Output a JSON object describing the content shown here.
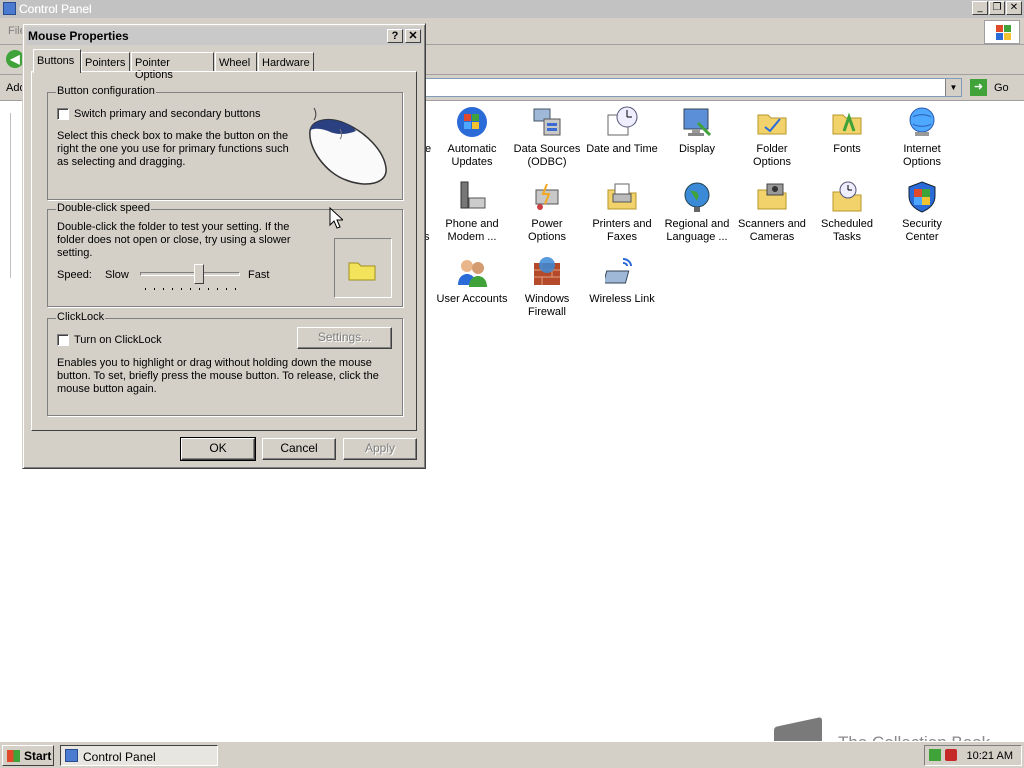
{
  "control_panel": {
    "title": "Control Panel",
    "menu_first": "File",
    "address_label": "Address",
    "go_label": "Go",
    "partial_labels": [
      "e",
      "s",
      "l"
    ],
    "icons": [
      {
        "label": "Automatic Updates",
        "icon": "automatic-updates-icon"
      },
      {
        "label": "Data Sources (ODBC)",
        "icon": "data-sources-icon"
      },
      {
        "label": "Date and Time",
        "icon": "date-time-icon"
      },
      {
        "label": "Display",
        "icon": "display-icon"
      },
      {
        "label": "Folder Options",
        "icon": "folder-options-icon"
      },
      {
        "label": "Fonts",
        "icon": "fonts-icon"
      },
      {
        "label": "Internet Options",
        "icon": "internet-options-icon"
      },
      {
        "label": "Phone and Modem ...",
        "icon": "phone-modem-icon"
      },
      {
        "label": "Power Options",
        "icon": "power-options-icon"
      },
      {
        "label": "Printers and Faxes",
        "icon": "printers-icon"
      },
      {
        "label": "Regional and Language ...",
        "icon": "regional-icon"
      },
      {
        "label": "Scanners and Cameras",
        "icon": "scanners-icon"
      },
      {
        "label": "Scheduled Tasks",
        "icon": "scheduled-tasks-icon"
      },
      {
        "label": "Security Center",
        "icon": "security-center-icon"
      },
      {
        "label": "User Accounts",
        "icon": "user-accounts-icon"
      },
      {
        "label": "Windows Firewall",
        "icon": "firewall-icon"
      },
      {
        "label": "Wireless Link",
        "icon": "wireless-link-icon"
      }
    ]
  },
  "dialog": {
    "title": "Mouse Properties",
    "help": "?",
    "close": "✕",
    "tabs": [
      "Buttons",
      "Pointers",
      "Pointer Options",
      "Wheel",
      "Hardware"
    ],
    "active_tab": "Buttons",
    "button_config": {
      "label": "Button configuration",
      "checkbox_label": "Switch primary and secondary buttons",
      "checked": false,
      "description": "Select this check box to make the button on the right the one you use for primary functions such as selecting and dragging."
    },
    "double_click": {
      "label": "Double-click speed",
      "description": "Double-click the folder to test your setting. If the folder does not open or close, try using a slower setting.",
      "speed_label": "Speed:",
      "slow": "Slow",
      "fast": "Fast",
      "value_fraction": 0.6
    },
    "clicklock": {
      "label": "ClickLock",
      "checkbox_label": "Turn on ClickLock",
      "checked": false,
      "settings_label": "Settings...",
      "description": "Enables you to highlight or drag without holding down the mouse button. To set, briefly press the mouse button. To release, click the mouse button again."
    },
    "ok": "OK",
    "cancel": "Cancel",
    "apply": "Apply"
  },
  "taskbar": {
    "start": "Start",
    "task_item": "Control Panel",
    "clock": "10:21 AM"
  },
  "watermark": "The Collection Book",
  "colors": {
    "face": "#d4d0c8",
    "accent_green": "#3fa33a"
  }
}
